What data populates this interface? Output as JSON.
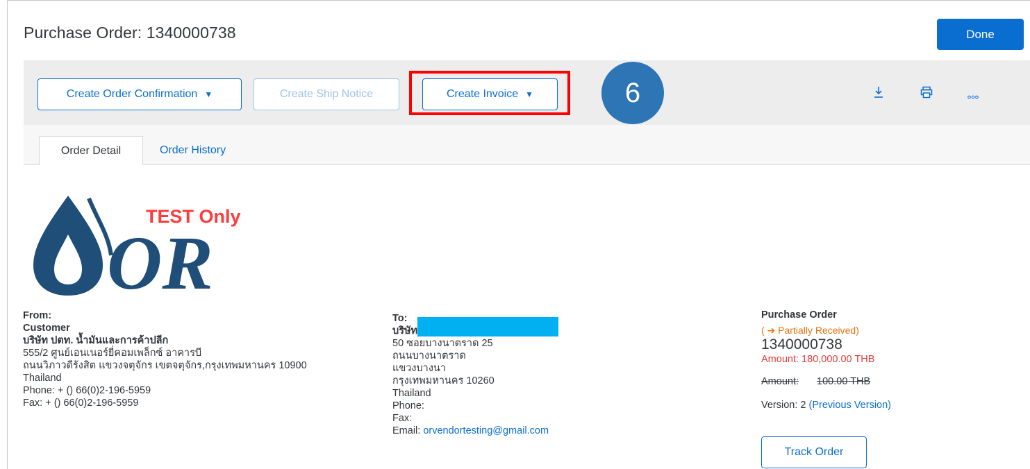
{
  "header": {
    "title": "Purchase Order: 1340000738",
    "done_label": "Done"
  },
  "toolbar": {
    "create_order_confirmation": "Create Order Confirmation",
    "create_ship_notice": "Create Ship Notice",
    "create_invoice": "Create Invoice",
    "step_number": "6",
    "icons": [
      "download-icon",
      "print-icon",
      "more-icon"
    ]
  },
  "tabs": [
    {
      "label": "Order Detail",
      "active": true
    },
    {
      "label": "Order History",
      "active": false
    }
  ],
  "logo": {
    "watermark": "TEST Only",
    "brand": "OR"
  },
  "from": {
    "heading": "From:",
    "name": "Customer",
    "company": "บริษัท ปตท. น้ำมันและการค้าปลีก",
    "address1": "555/2 ศูนย์เอนเนอร์ยี่คอมเพล็กซ์ อาคารบี",
    "address2": "ถนนวิภาวดีรังสิต แขวงจตุจักร เขตจตุจักร,กรุงเทพมหานคร 10900",
    "country": "Thailand",
    "phone": "Phone:  + () 66(0)2-196-5959",
    "fax": "Fax:  + () 66(0)2-196-5959"
  },
  "to": {
    "heading": "To:",
    "company_prefix": "บริษัท",
    "address1": "50 ซอยบางนาตราด 25",
    "address2": "ถนนบางนาตราด",
    "address3": "แขวงบางนา",
    "address4": "กรุงเทพมหานคร 10260",
    "country": "Thailand",
    "phone": "Phone:",
    "fax": "Fax:",
    "email_label": "Email:",
    "email": "orvendortesting@gmail.com"
  },
  "po": {
    "heading": "Purchase Order",
    "status": "( ➔ Partially Received)",
    "number": "1340000738",
    "amount": "Amount: 180,000.00 THB",
    "old_amount_label": "Amount:",
    "old_amount_value": "100.00 THB",
    "version": "Version: 2",
    "previous_version": "(Previous Version)",
    "track_order": "Track Order"
  },
  "colors": {
    "accent": "#0a6ed1",
    "highlight": "#ff0000",
    "badge": "#2e75b6",
    "logo": "#1f4e79",
    "watermark": "#ff3b3b",
    "status": "#e9730c",
    "amount": "#e03b3b",
    "redaction": "#00b0f0"
  }
}
